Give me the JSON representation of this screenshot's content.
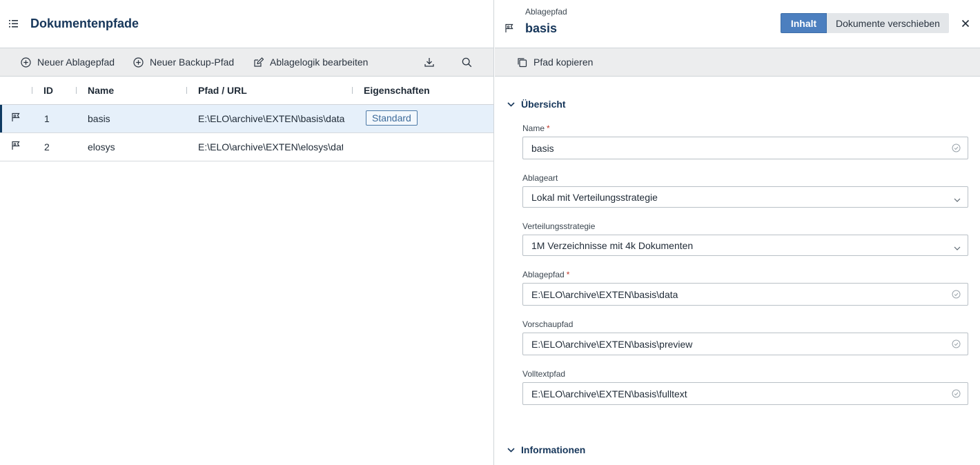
{
  "left": {
    "title": "Dokumentenpfade",
    "toolbar": {
      "new_path": "Neuer Ablagepfad",
      "new_backup": "Neuer Backup-Pfad",
      "edit_logic": "Ablagelogik bearbeiten"
    },
    "columns": {
      "id": "ID",
      "name": "Name",
      "path": "Pfad / URL",
      "props": "Eigenschaften"
    },
    "rows": [
      {
        "id": "1",
        "name": "basis",
        "path": "E:\\ELO\\archive\\EXTEN\\basis\\data",
        "badge": "Standard"
      },
      {
        "id": "2",
        "name": "elosys",
        "path": "E:\\ELO\\archive\\EXTEN\\elosys\\dat",
        "badge": ""
      }
    ]
  },
  "right": {
    "subtitle": "Ablagepfad",
    "title": "basis",
    "tabs": {
      "active": "Inhalt",
      "inactive": "Dokumente verschieben"
    },
    "toolbar": {
      "copy": "Pfad kopieren"
    },
    "sections": {
      "overview": "Übersicht",
      "info": "Informationen"
    },
    "fields": {
      "name": {
        "label": "Name",
        "value": "basis",
        "required": "*"
      },
      "storage_type": {
        "label": "Ablageart",
        "value": "Lokal mit Verteilungsstrategie"
      },
      "strategy": {
        "label": "Verteilungsstrategie",
        "value": "1M Verzeichnisse mit 4k Dokumenten"
      },
      "storage_path": {
        "label": "Ablagepfad",
        "value": "E:\\ELO\\archive\\EXTEN\\basis\\data",
        "required": "*"
      },
      "preview_path": {
        "label": "Vorschaupfad",
        "value": "E:\\ELO\\archive\\EXTEN\\basis\\preview"
      },
      "fulltext_path": {
        "label": "Volltextpfad",
        "value": "E:\\ELO\\archive\\EXTEN\\basis\\fulltext"
      }
    }
  },
  "colors": {
    "accent": "#4c7fbf",
    "title": "#16365a",
    "selected_row": "#e6f0fa",
    "selected_bar": "#0f3a62",
    "required": "#c0392b"
  }
}
